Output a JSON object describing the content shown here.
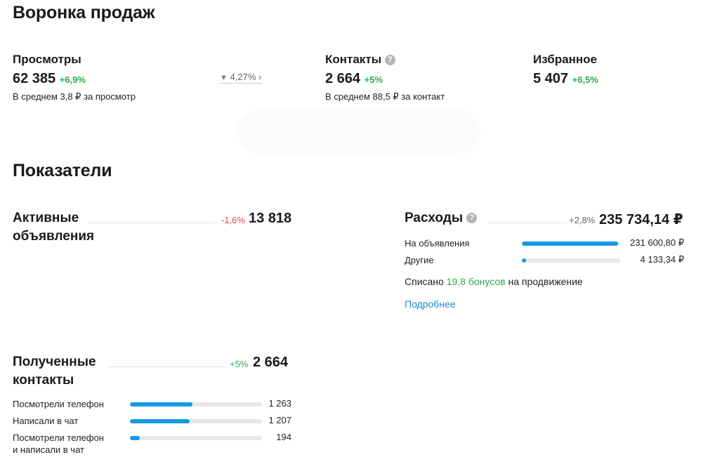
{
  "funnel": {
    "title": "Воронка продаж",
    "views": {
      "label": "Просмотры",
      "value": "62 385",
      "change": "+6,9%",
      "avg": "В среднем 3,8 ₽ за просмотр"
    },
    "conversion": {
      "value": "4,27%",
      "icon": "filter-icon",
      "chevron": "›"
    },
    "contacts": {
      "label": "Контакты",
      "help": "?",
      "value": "2 664",
      "change": "+5%",
      "avg": "В среднем 88,5 ₽ за контакт"
    },
    "favorites": {
      "label": "Избранное",
      "value": "5 407",
      "change": "+6,5%"
    }
  },
  "indicators": {
    "title": "Показатели",
    "active_ads": {
      "title_line1": "Активные",
      "title_line2": "объявления",
      "change": "-1,6%",
      "value": "13 818"
    },
    "expenses": {
      "title": "Расходы",
      "help": "?",
      "change": "+2,8%",
      "value": "235 734,14 ₽",
      "rows": [
        {
          "label": "На объявления",
          "value": "231 600,80 ₽",
          "fill": 0.982
        },
        {
          "label": "Другие",
          "value": "4 133,34 ₽",
          "fill": 0.04
        }
      ],
      "written_off_prefix": "Списано",
      "written_off_bonus": "19,8 бонусов",
      "written_off_suffix": "на продвижение",
      "more_link": "Подробнее"
    },
    "contacts_received": {
      "title_line1": "Полученные",
      "title_line2": "контакты",
      "change": "+5%",
      "value": "2 664",
      "rows": [
        {
          "label": "Посмотрели телефон",
          "value": "1 263",
          "fill": 0.474
        },
        {
          "label": "Написали в чат",
          "value": "1 207",
          "fill": 0.453
        },
        {
          "label_line1": "Посмотрели телефон",
          "label_line2": "и написали в чат",
          "value": "194",
          "fill": 0.073
        }
      ]
    }
  },
  "colors": {
    "accent": "#119be3",
    "positive": "#2fa84f",
    "negative": "#e04848",
    "link": "#1a8bd6"
  }
}
